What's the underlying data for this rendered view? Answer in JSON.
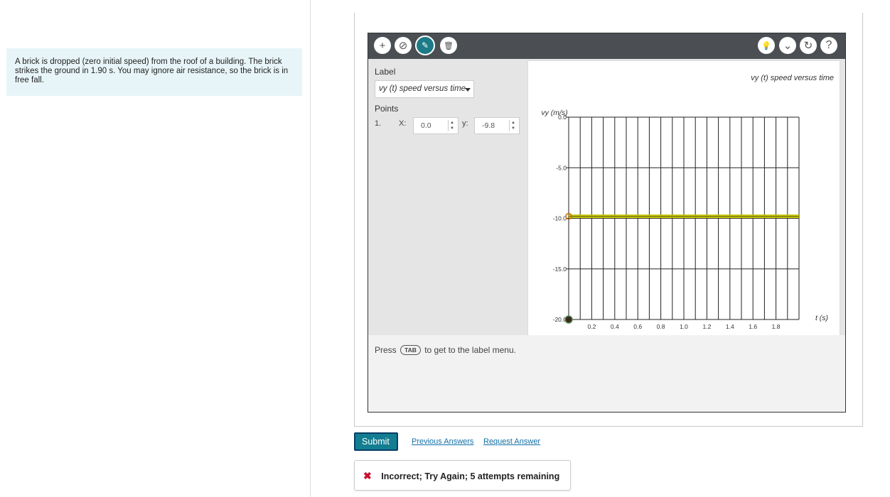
{
  "problem": {
    "text": "A brick is dropped (zero initial speed) from the roof of a building. The brick strikes the ground in 1.90 s. You may ignore air resistance, so the brick is in free fall."
  },
  "toolbar": {
    "left_buttons": [
      {
        "icon": "plus-icon",
        "glyph": "+"
      },
      {
        "icon": "no-point-icon",
        "glyph": "⊘"
      },
      {
        "icon": "add-label-icon",
        "glyph": "✎"
      },
      {
        "icon": "trash-icon",
        "glyph": "🗑"
      }
    ],
    "right_buttons": [
      {
        "icon": "hint-bulb-icon",
        "glyph": "💡"
      },
      {
        "icon": "chevron-down-icon",
        "glyph": "⌄"
      },
      {
        "icon": "reset-icon",
        "glyph": "↻"
      },
      {
        "icon": "help-icon",
        "glyph": "?"
      }
    ]
  },
  "side": {
    "label_heading": "Label",
    "select_value": "vy (t) speed versus time",
    "points_heading": "Points",
    "point_index": "1.",
    "x_label": "X:",
    "x_value": "0.0",
    "y_label": "y:",
    "y_value": "-9.8"
  },
  "hint": {
    "press": "Press",
    "key": "TAB",
    "rest": "to get to the label menu."
  },
  "chart_data": {
    "type": "line",
    "title": "vy (t) speed versus time",
    "ylabel": "vy (m/s)",
    "xlabel": "t (s)",
    "ylim": [
      -20,
      0
    ],
    "xlim": [
      0,
      2.0
    ],
    "yticks": [
      "0.0",
      "-5.0",
      "-10.0",
      "-15.0",
      "-20.0"
    ],
    "xticks": [
      "0.2",
      "0.4",
      "0.6",
      "0.8",
      "1.0",
      "1.2",
      "1.4",
      "1.6",
      "1.8"
    ],
    "grid": true,
    "series": [
      {
        "x": [
          0.0,
          2.0
        ],
        "y": [
          -9.8,
          -9.8
        ],
        "color": "#c8c800"
      }
    ],
    "points": [
      {
        "x": 0.0,
        "y": -9.8
      }
    ]
  },
  "actions": {
    "submit": "Submit",
    "previous_answers": "Previous Answers",
    "request_answer": "Request Answer"
  },
  "feedback": {
    "icon": "✖",
    "text": "Incorrect; Try Again; 5 attempts remaining"
  }
}
